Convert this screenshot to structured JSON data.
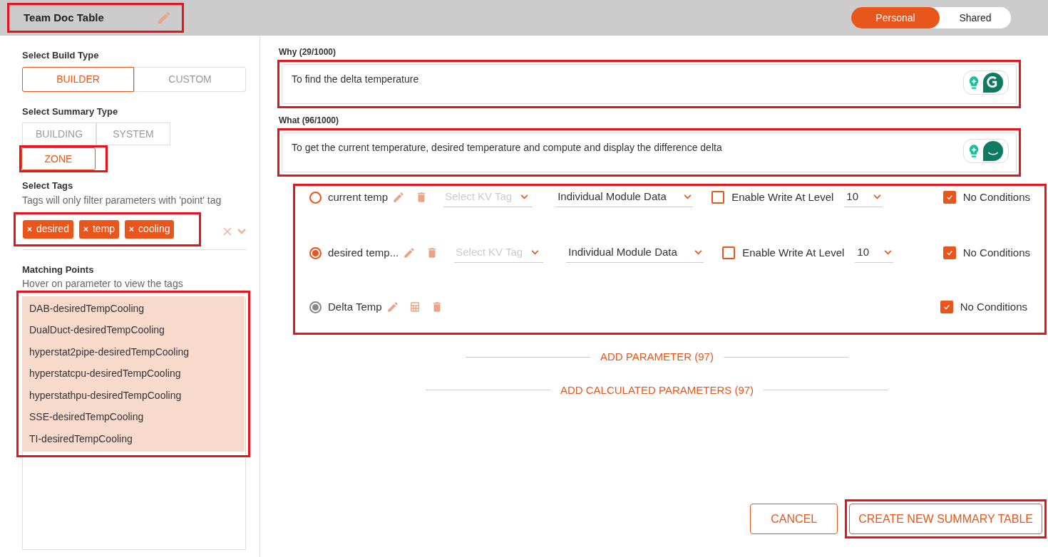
{
  "header": {
    "title": "Team Doc Table",
    "highlighted": true,
    "scope_toggle": [
      {
        "label": "Personal",
        "selected": true
      },
      {
        "label": "Shared",
        "selected": false
      }
    ]
  },
  "build_type": {
    "label": "Select Build Type",
    "options": [
      {
        "label": "BUILDER",
        "selected": true
      },
      {
        "label": "CUSTOM",
        "selected": false
      }
    ]
  },
  "summary_type": {
    "label": "Select Summary Type",
    "options": [
      {
        "label": "BUILDING",
        "selected": false,
        "highlighted": false
      },
      {
        "label": "SYSTEM",
        "selected": false,
        "highlighted": false
      },
      {
        "label": "ZONE",
        "selected": true,
        "highlighted": true
      }
    ]
  },
  "tags": {
    "label": "Select Tags",
    "hint": "Tags will only filter parameters with 'point' tag",
    "highlighted": true,
    "chips": [
      {
        "remove": "×",
        "label": "desired"
      },
      {
        "remove": "×",
        "label": "temp"
      },
      {
        "remove": "×",
        "label": "cooling"
      }
    ]
  },
  "matching_points": {
    "label": "Matching Points",
    "hint": "Hover on parameter to view the tags",
    "highlighted": true,
    "items": [
      "DAB-desiredTempCooling",
      "DualDuct-desiredTempCooling",
      "hyperstat2pipe-desiredTempCooling",
      "hyperstatcpu-desiredTempCooling",
      "hyperstathpu-desiredTempCooling",
      "SSE-desiredTempCooling",
      "TI-desiredTempCooling"
    ]
  },
  "why": {
    "label": "Why (29/1000)",
    "value": "To find the delta temperature",
    "highlighted": true
  },
  "what": {
    "label": "What (96/1000)",
    "value": "To get the current temperature, desired temperature and compute and display the difference delta",
    "highlighted": true
  },
  "parameters": {
    "highlighted": true,
    "items": [
      {
        "kind": "point",
        "name": "current temp",
        "selected": false,
        "kv_tag_placeholder": "Select KV Tag",
        "module": "Individual Module Data",
        "write_label": "Enable Write At Level",
        "write_enabled": false,
        "level_value": "10",
        "no_conditions_label": "No Conditions",
        "no_conditions": true
      },
      {
        "kind": "point",
        "name": "desired temp...",
        "selected": true,
        "kv_tag_placeholder": "Select KV Tag",
        "module": "Individual Module Data",
        "write_label": "Enable Write At Level",
        "write_enabled": false,
        "level_value": "10",
        "no_conditions_label": "No Conditions",
        "no_conditions": true
      },
      {
        "kind": "calculated",
        "name": "Delta Temp",
        "selected": true,
        "no_conditions_label": "No Conditions",
        "no_conditions": true
      }
    ]
  },
  "add_parameter": "ADD PARAMETER (97)",
  "add_calculated": "ADD CALCULATED PARAMETERS (97)",
  "footer": {
    "cancel": "CANCEL",
    "create": "CREATE NEW SUMMARY TABLE",
    "create_highlighted": true
  }
}
